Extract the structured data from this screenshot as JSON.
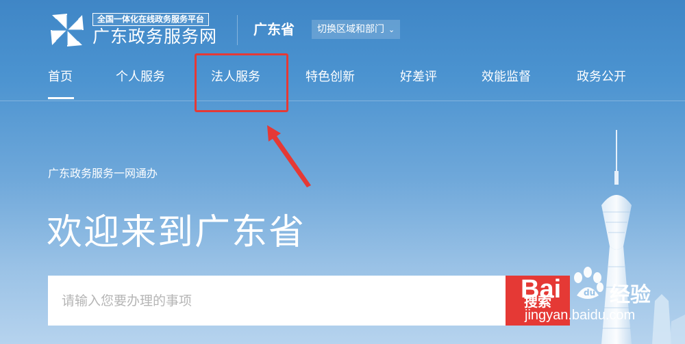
{
  "header": {
    "logo_icon": "pinwheel-logo-icon",
    "logo_badge": "全国一体化在线政务服务平台",
    "logo_name": "广东政务服务网",
    "province": "广东省",
    "switch_region_label": "切换区域和部门",
    "switch_region_icon": "chevron-down-icon"
  },
  "nav": {
    "items": [
      {
        "label": "首页",
        "active": true
      },
      {
        "label": "个人服务",
        "active": false
      },
      {
        "label": "法人服务",
        "active": false
      },
      {
        "label": "特色创新",
        "active": false
      },
      {
        "label": "好差评",
        "active": false
      },
      {
        "label": "效能监督",
        "active": false
      },
      {
        "label": "政务公开",
        "active": false
      }
    ]
  },
  "hero": {
    "subtitle": "广东政务服务一网通办",
    "welcome": "欢迎来到广东省"
  },
  "search": {
    "placeholder": "请输入您要办理的事项",
    "value": "",
    "button_label": "搜索"
  },
  "annotation": {
    "highlight_target": "法人服务",
    "box_color": "#e53935",
    "arrow_color": "#e53935"
  },
  "watermark": {
    "brand_left": "Bai",
    "paw_icon": "baidu-paw-icon",
    "brand_right": "经验",
    "url": "jingyan.baidu.com"
  },
  "colors": {
    "accent_red": "#e53935",
    "bg_top": "#3f86c6",
    "bg_bottom": "#b6d3ee"
  }
}
